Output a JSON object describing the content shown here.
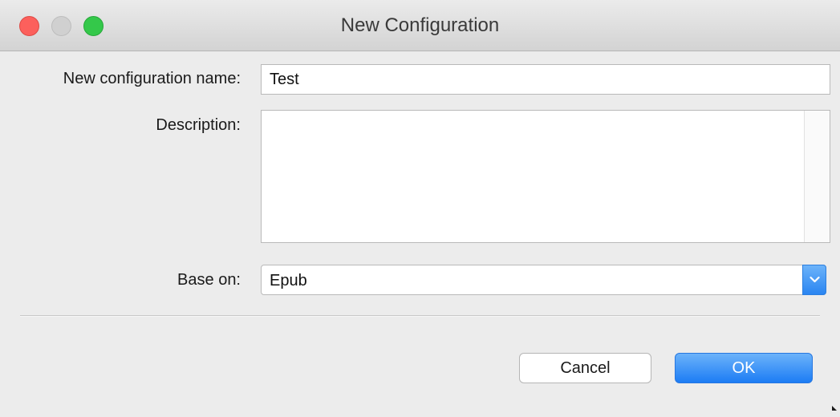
{
  "window": {
    "title": "New Configuration"
  },
  "form": {
    "name_label": "New configuration name:",
    "name_value": "Test",
    "description_label": "Description:",
    "description_value": "",
    "base_label": "Base on:",
    "base_value": "Epub"
  },
  "buttons": {
    "cancel_label": "Cancel",
    "ok_label": "OK"
  },
  "colors": {
    "accent": "#2a85f1",
    "close": "#fc605c",
    "zoom": "#34c84a"
  }
}
